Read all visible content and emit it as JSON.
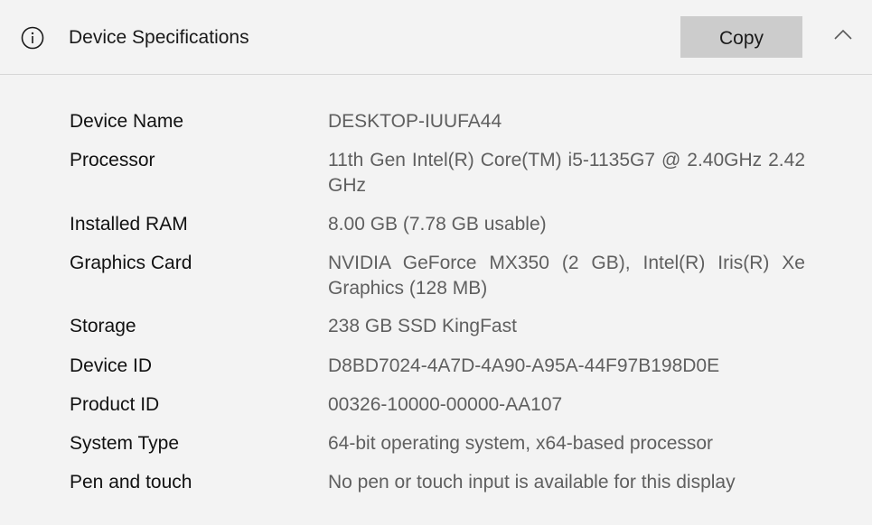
{
  "header": {
    "title": "Device Specifications",
    "copy_label": "Copy",
    "info_icon": "info-icon",
    "collapse_icon": "chevron-up-icon"
  },
  "specs": [
    {
      "label": "Device Name",
      "value": "DESKTOP-IUUFA44"
    },
    {
      "label": "Processor",
      "value": "11th Gen Intel(R) Core(TM) i5-1135G7 @ 2.40GHz   2.42 GHz"
    },
    {
      "label": "Installed RAM",
      "value": "8.00 GB (7.78 GB usable)"
    },
    {
      "label": "Graphics Card",
      "value": "NVIDIA GeForce MX350 (2 GB), Intel(R) Iris(R) Xe Graphics (128 MB)"
    },
    {
      "label": "Storage",
      "value": "238 GB SSD KingFast"
    },
    {
      "label": "Device ID",
      "value": "D8BD7024-4A7D-4A90-A95A-44F97B198D0E"
    },
    {
      "label": "Product ID",
      "value": "00326-10000-00000-AA107"
    },
    {
      "label": "System Type",
      "value": "64-bit operating system, x64-based processor"
    },
    {
      "label": "Pen and touch",
      "value": "No pen or touch input is available for this display"
    }
  ]
}
